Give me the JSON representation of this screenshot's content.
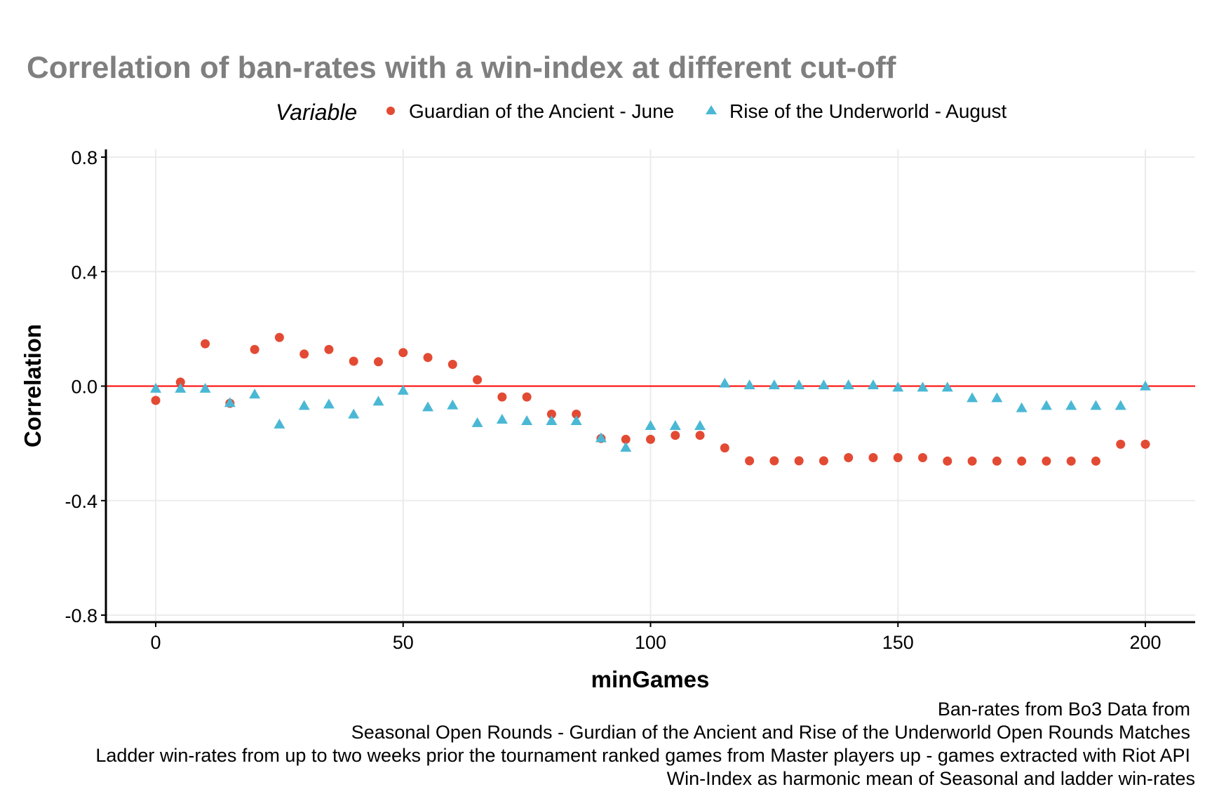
{
  "chart_data": {
    "type": "scatter",
    "title": "Correlation of ban-rates with a win-index at different cut-off",
    "xlabel": "minGames",
    "ylabel": "Correlation",
    "xlim": [
      -10,
      210
    ],
    "ylim": [
      -0.82,
      0.82
    ],
    "xticks": [
      0,
      50,
      100,
      150,
      200
    ],
    "xtick_labels": [
      "0",
      "50",
      "100",
      "150",
      "200"
    ],
    "yticks": [
      0.8,
      0.4,
      0.0,
      -0.4,
      -0.8
    ],
    "ytick_labels": [
      "0.8",
      "0.4",
      "0.0",
      "-0.4",
      "-0.8"
    ],
    "grid": true,
    "reference_line": {
      "y": 0,
      "color": "#ff0000"
    },
    "legend": {
      "title": "Variable",
      "position": "top"
    },
    "x": [
      0,
      5,
      10,
      15,
      20,
      25,
      30,
      35,
      40,
      45,
      50,
      55,
      60,
      65,
      70,
      75,
      80,
      85,
      90,
      95,
      100,
      105,
      110,
      115,
      120,
      125,
      130,
      135,
      140,
      145,
      150,
      155,
      160,
      165,
      170,
      175,
      180,
      185,
      190,
      195,
      200
    ],
    "series": [
      {
        "name": "Guardian of the Ancient - June",
        "marker": "circle",
        "color": "#e34a33",
        "values": [
          -0.05,
          0.014,
          0.148,
          -0.06,
          0.128,
          0.17,
          0.112,
          0.128,
          0.087,
          0.085,
          0.117,
          0.1,
          0.076,
          0.022,
          -0.038,
          -0.038,
          -0.098,
          -0.098,
          -0.183,
          -0.186,
          -0.186,
          -0.172,
          -0.172,
          -0.216,
          -0.261,
          -0.261,
          -0.261,
          -0.261,
          -0.25,
          -0.25,
          -0.25,
          -0.25,
          -0.262,
          -0.262,
          -0.262,
          -0.262,
          -0.262,
          -0.262,
          -0.262,
          -0.203,
          -0.203
        ]
      },
      {
        "name": "Rise of the Underworld - August",
        "marker": "triangle",
        "color": "#4ab8d5",
        "values": [
          -0.01,
          -0.01,
          -0.01,
          -0.06,
          -0.03,
          -0.135,
          -0.07,
          -0.065,
          -0.1,
          -0.055,
          -0.017,
          -0.075,
          -0.068,
          -0.13,
          -0.118,
          -0.123,
          -0.123,
          -0.123,
          -0.183,
          -0.216,
          -0.14,
          -0.14,
          -0.14,
          0.008,
          0.002,
          0.002,
          0.002,
          0.002,
          0.002,
          0.002,
          -0.006,
          -0.006,
          -0.006,
          -0.043,
          -0.043,
          -0.078,
          -0.07,
          -0.07,
          -0.07,
          -0.07,
          -0.002
        ]
      }
    ],
    "caption": [
      "Ban-rates from Bo3 Data from",
      "Seasonal Open Rounds - Gurdian of the Ancient and Rise of the Underworld Open Rounds Matches",
      "Ladder win-rates from up to two weeks prior the tournament ranked games from Master players up - games extracted with Riot API",
      "Win-Index as harmonic mean of Seasonal and ladder win-rates"
    ]
  }
}
